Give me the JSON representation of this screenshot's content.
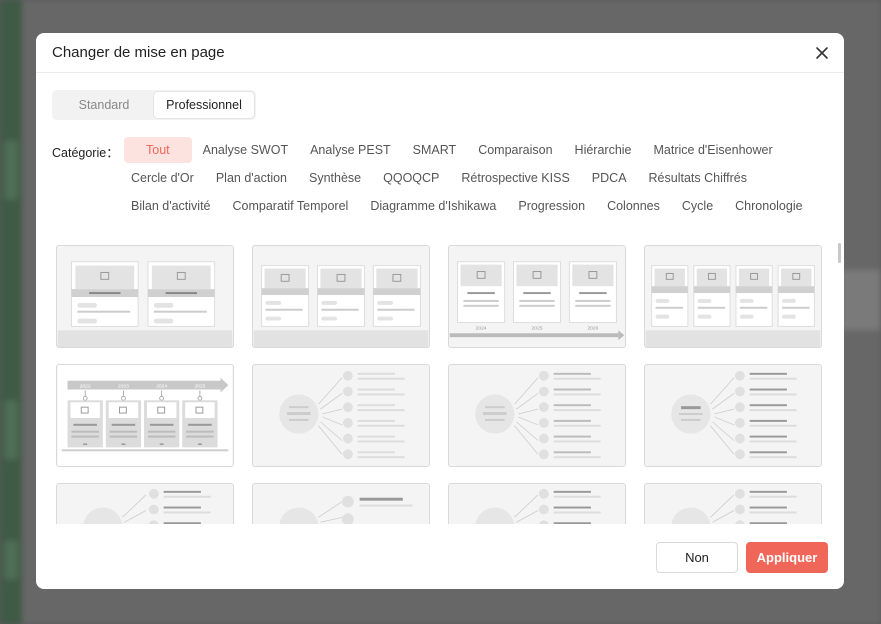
{
  "modal": {
    "title": "Changer de mise en page",
    "tabs": [
      {
        "label": "Standard",
        "active": false
      },
      {
        "label": "Professionnel",
        "active": true
      }
    ],
    "category_label": "Catégorie：",
    "categories_row1": [
      "Tout",
      "Analyse SWOT",
      "Analyse PEST",
      "SMART",
      "Comparaison",
      "Hiérarchie",
      "Matrice d'Eisenhower"
    ],
    "categories_row2": [
      "Cercle d'Or",
      "Plan d'action",
      "Synthèse",
      "QQOQCP",
      "Rétrospective KISS",
      "PDCA",
      "Résultats Chiffrés"
    ],
    "categories_row3": [
      "Bilan d'activité",
      "Comparatif Temporel",
      "Diagramme d'Ishikawa",
      "Progression",
      "Colonnes",
      "Cycle",
      "Chronologie"
    ],
    "active_category": "Tout",
    "thumb_years_a": [
      "2024",
      "2025",
      "2026"
    ],
    "thumb_years_b": [
      "2022",
      "2023",
      "2024",
      "2025"
    ],
    "cancel_label": "Non",
    "apply_label": "Appliquer"
  },
  "colors": {
    "accent": "#f0675a",
    "accent_soft": "#fde3df"
  },
  "icons": {
    "close": "close-icon"
  }
}
